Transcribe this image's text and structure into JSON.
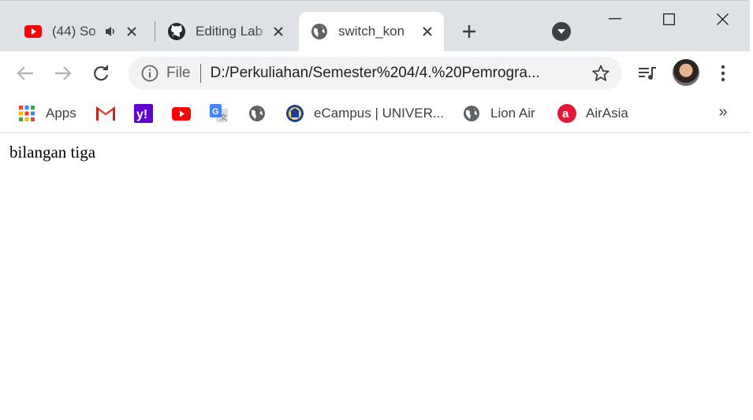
{
  "browser": {
    "tabs": [
      {
        "title": "(44) So",
        "favicon": "youtube-icon",
        "audio": true
      },
      {
        "title": "Editing Lab",
        "favicon": "github-icon",
        "audio": false
      },
      {
        "title": "switch_kon",
        "favicon": "globe-icon",
        "audio": false,
        "active": true
      }
    ],
    "new_tab": "+"
  },
  "toolbar": {
    "omnibox": {
      "scheme_label": "File",
      "url": "D:/Perkuliahan/Semester%204/4.%20Pemrogra..."
    }
  },
  "bookmarks": {
    "items": [
      {
        "label": "Apps",
        "icon": "apps-grid-icon"
      },
      {
        "label": "",
        "icon": "gmail-icon"
      },
      {
        "label": "",
        "icon": "yahoo-icon"
      },
      {
        "label": "",
        "icon": "youtube-icon"
      },
      {
        "label": "",
        "icon": "google-translate-icon"
      },
      {
        "label": "",
        "icon": "globe-icon"
      },
      {
        "label": "eCampus | UNIVER...",
        "icon": "university-seal-icon"
      },
      {
        "label": "Lion Air",
        "icon": "globe-icon"
      },
      {
        "label": "AirAsia",
        "icon": "airasia-icon"
      }
    ],
    "more": "»"
  },
  "page": {
    "text": "bilangan tiga"
  },
  "colors": {
    "tabstrip": "#dee1e6",
    "omnibox": "#f1f3f4",
    "youtube_red": "#ff0000",
    "yahoo_purple": "#6001d2",
    "airasia_red": "#e31837"
  }
}
